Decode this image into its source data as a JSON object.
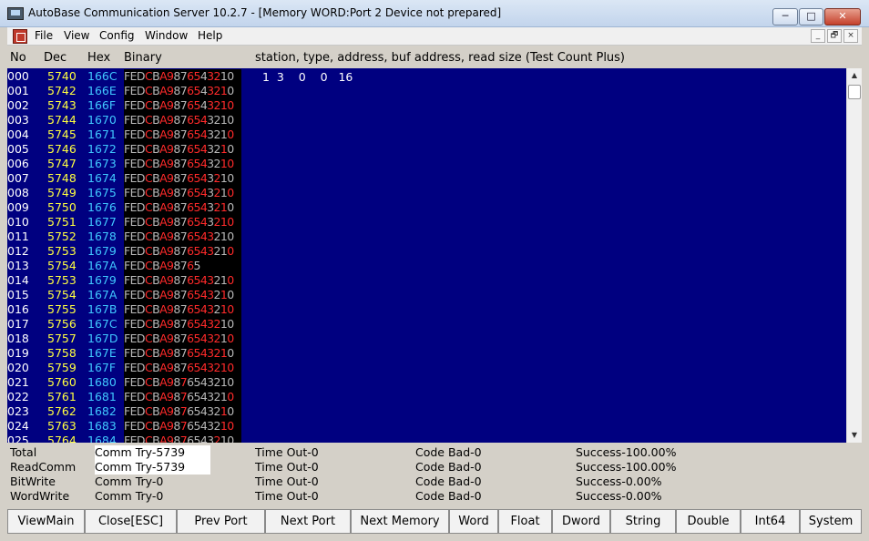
{
  "window": {
    "title": "AutoBase Communication Server 10.2.7 - [Memory WORD:Port 2 Device not prepared]",
    "minimize": "─",
    "maximize": "□",
    "close": "✕"
  },
  "menu": {
    "items": [
      "File",
      "View",
      "Config",
      "Window",
      "Help"
    ],
    "mdi": [
      "_",
      "🗗",
      "×"
    ]
  },
  "columns": {
    "no": "No",
    "dec": "Dec",
    "hex": "Hex",
    "binary": "Binary",
    "params": "station, type, address, buf address, read size (Test Count Plus)"
  },
  "param_values": "1  3    0    0   16",
  "binary_template": "FEDCBA9876543210",
  "colors": {
    "data_bg": "#000080",
    "no": "#ffffff",
    "dec": "#ffff40",
    "hex": "#40c8ff",
    "bit_on": "#ff2a2a",
    "bit_off": "#b8b8b8"
  },
  "rows": [
    {
      "no": "000",
      "dec": "5740",
      "hex": "166C",
      "bits": "0001011001101100"
    },
    {
      "no": "001",
      "dec": "5742",
      "hex": "166E",
      "bits": "0001011001101110"
    },
    {
      "no": "002",
      "dec": "5743",
      "hex": "166F",
      "bits": "0001011001101111"
    },
    {
      "no": "003",
      "dec": "5744",
      "hex": "1670",
      "bits": "0001011001110000"
    },
    {
      "no": "004",
      "dec": "5745",
      "hex": "1671",
      "bits": "0001011001110001"
    },
    {
      "no": "005",
      "dec": "5746",
      "hex": "1672",
      "bits": "0001011001110010"
    },
    {
      "no": "006",
      "dec": "5747",
      "hex": "1673",
      "bits": "0001011001110011"
    },
    {
      "no": "007",
      "dec": "5748",
      "hex": "1674",
      "bits": "0001011001110100"
    },
    {
      "no": "008",
      "dec": "5749",
      "hex": "1675",
      "bits": "0001011001110101"
    },
    {
      "no": "009",
      "dec": "5750",
      "hex": "1676",
      "bits": "0001011001110110"
    },
    {
      "no": "010",
      "dec": "5751",
      "hex": "1677",
      "bits": "0001011001110111"
    },
    {
      "no": "011",
      "dec": "5752",
      "hex": "1678",
      "bits": "0001011001111000"
    },
    {
      "no": "012",
      "dec": "5753",
      "hex": "1679",
      "bits": "0001011001111001"
    },
    {
      "no": "013",
      "dec": "5754",
      "hex": "167A",
      "bits": "0001011001",
      "partial": "FEDCBA98765"
    },
    {
      "no": "014",
      "dec": "5753",
      "hex": "1679",
      "bits": "0001011001111001"
    },
    {
      "no": "015",
      "dec": "5754",
      "hex": "167A",
      "bits": "0001011001111010"
    },
    {
      "no": "016",
      "dec": "5755",
      "hex": "167B",
      "bits": "0001011001111011"
    },
    {
      "no": "017",
      "dec": "5756",
      "hex": "167C",
      "bits": "0001011001111100"
    },
    {
      "no": "018",
      "dec": "5757",
      "hex": "167D",
      "bits": "0001011001111101"
    },
    {
      "no": "019",
      "dec": "5758",
      "hex": "167E",
      "bits": "0001011001111110"
    },
    {
      "no": "020",
      "dec": "5759",
      "hex": "167F",
      "bits": "0001011001111111"
    },
    {
      "no": "021",
      "dec": "5760",
      "hex": "1680",
      "bits": "0001011010000000"
    },
    {
      "no": "022",
      "dec": "5761",
      "hex": "1681",
      "bits": "0001011010000001"
    },
    {
      "no": "023",
      "dec": "5762",
      "hex": "1682",
      "bits": "0001011010000010"
    },
    {
      "no": "024",
      "dec": "5763",
      "hex": "1683",
      "bits": "0001011010000011"
    },
    {
      "no": "025",
      "dec": "5764",
      "hex": "1684",
      "bits": "0001011010000100"
    }
  ],
  "stats": [
    {
      "label": "Total",
      "comm": "Comm Try-5739",
      "timeout": "Time Out-0",
      "codebad": "Code Bad-0",
      "success": "Success-100.00%",
      "highlight": true
    },
    {
      "label": "ReadComm",
      "comm": "Comm Try-5739",
      "timeout": "Time Out-0",
      "codebad": "Code Bad-0",
      "success": "Success-100.00%",
      "highlight": true
    },
    {
      "label": "BitWrite",
      "comm": "Comm Try-0",
      "timeout": "Time Out-0",
      "codebad": "Code Bad-0",
      "success": "Success-0.00%",
      "highlight": false
    },
    {
      "label": "WordWrite",
      "comm": "Comm Try-0",
      "timeout": "Time Out-0",
      "codebad": "Code Bad-0",
      "success": "Success-0.00%",
      "highlight": false
    }
  ],
  "buttons": [
    "ViewMain",
    "Close[ESC]",
    "Prev Port",
    "Next Port",
    "Next Memory",
    "Word",
    "Float",
    "Dword",
    "String",
    "Double",
    "Int64",
    "System"
  ]
}
